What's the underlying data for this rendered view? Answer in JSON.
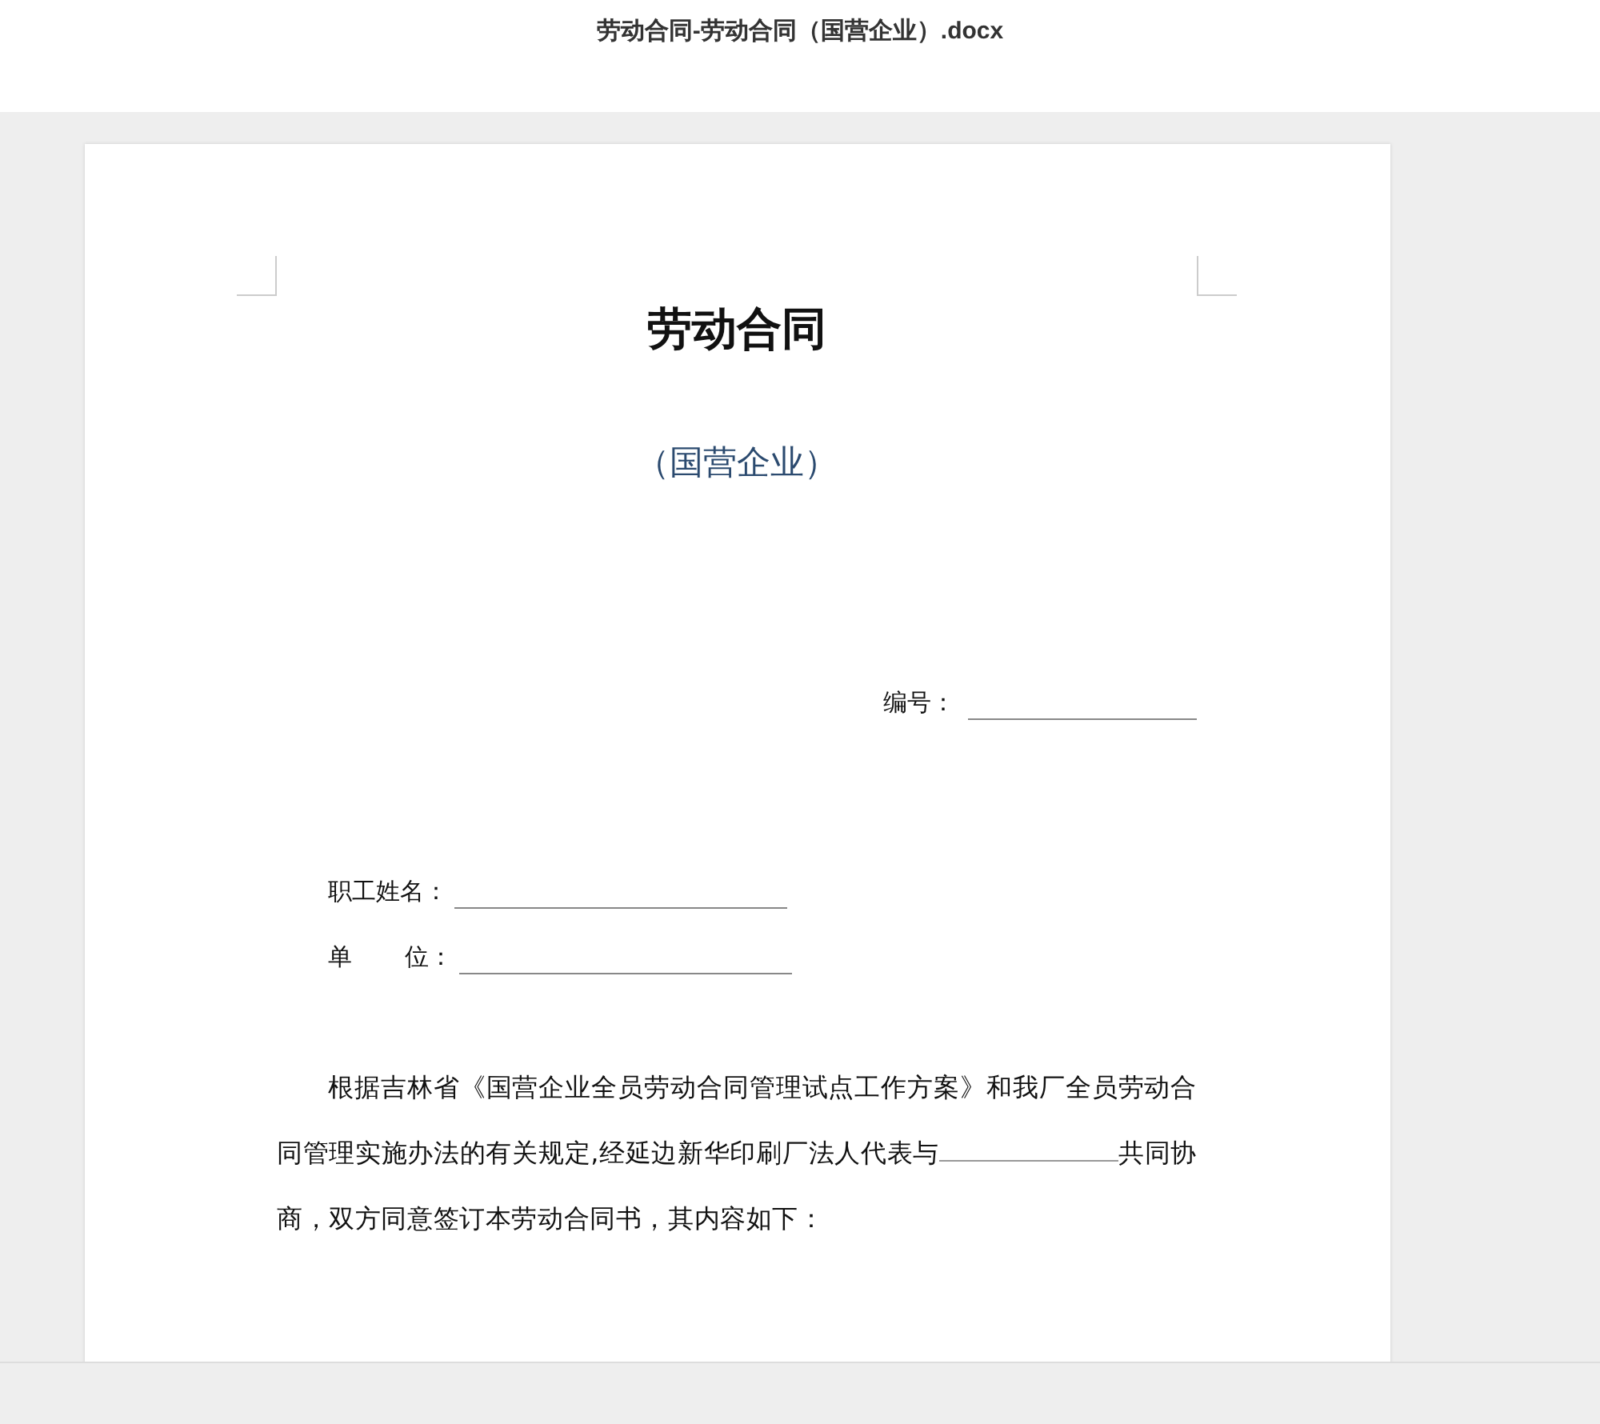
{
  "window": {
    "title": "劳动合同-劳动合同（国营企业）.docx"
  },
  "document": {
    "title": "劳动合同",
    "subtitle": "（国营企业）",
    "number_label": "编号：",
    "fields": [
      {
        "label": "职工姓名："
      },
      {
        "label_parts": [
          "单",
          "位："
        ]
      }
    ],
    "paragraph": {
      "text_before": "根据吉林省《国营企业全员劳动合同管理试点工作方案》和我厂全员劳动合同管理实施办法的有关规定,经延边新华印刷厂法人代表与",
      "text_after": "共同协商，双方同意签订本劳动合同书，其内容如下："
    }
  }
}
